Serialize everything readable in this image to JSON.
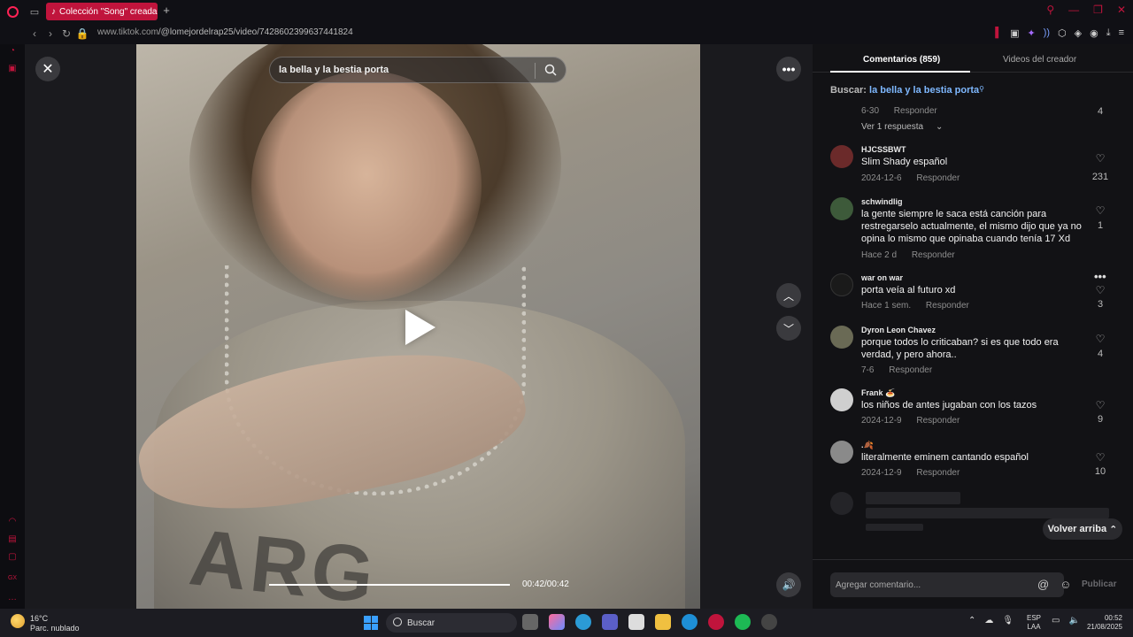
{
  "browser": {
    "tab_title": "Colección \"Song\" creada",
    "url_host": "www.tiktok.com",
    "url_path": "/@lomejordelrap25/video/7428602399637441824"
  },
  "video": {
    "search_query": "la bella y la bestia porta",
    "time": "00:42/00:42",
    "progress_fraction": 1.0,
    "shirt_text": "ARG"
  },
  "panel": {
    "tab_comments": "Comentarios (859)",
    "tab_creator": "Videos del creador",
    "buscar_label": "Buscar:",
    "buscar_query": "la bella y la bestia porta",
    "partial": {
      "date": "6-30",
      "reply": "Responder",
      "likes": "4",
      "view_replies": "Ver 1 respuesta"
    },
    "comments": [
      {
        "user": "HJCSSBWT",
        "text": "Slim Shady español",
        "date": "2024-12-6",
        "reply": "Responder",
        "likes": "231",
        "avatar_color": "#6b2a2a"
      },
      {
        "user": "schwindlig",
        "text": "la gente siempre le saca está canción para restregarselo actualmente, el mismo dijo que ya no opina lo mismo que opinaba cuando tenía 17 Xd",
        "date": "Hace 2 d",
        "reply": "Responder",
        "likes": "1",
        "avatar_color": "#3d5a3a"
      },
      {
        "user": "war on war",
        "text": "porta veía al futuro xd",
        "date": "Hace 1 sem.",
        "reply": "Responder",
        "likes": "3",
        "avatar_color": "#1a1a1a"
      },
      {
        "user": "Dyron Leon Chavez",
        "text": "porque todos lo criticaban? si es que todo era verdad, y pero ahora..",
        "date": "7-6",
        "reply": "Responder",
        "likes": "4",
        "avatar_color": "#6a6a55"
      },
      {
        "user": "Frank 🍝",
        "text": "los niños de antes jugaban con los tazos",
        "date": "2024-12-9",
        "reply": "Responder",
        "likes": "9",
        "avatar_color": "#cfcfcf"
      },
      {
        "user": ".🍂",
        "text": "literalmente eminem cantando español",
        "date": "2024-12-9",
        "reply": "Responder",
        "likes": "10",
        "avatar_color": "#8a8a8a"
      }
    ],
    "back_to_top": "Volver arriba",
    "compose_placeholder": "Agregar comentario...",
    "publish": "Publicar"
  },
  "taskbar": {
    "temp": "16°C",
    "weather": "Parc. nublado",
    "search": "Buscar",
    "lang1": "ESP",
    "lang2": "LAA",
    "time": "00:52",
    "date": "21/08/2025"
  },
  "colors": {
    "accent": "#c0143c",
    "link": "#7eb8ff"
  }
}
